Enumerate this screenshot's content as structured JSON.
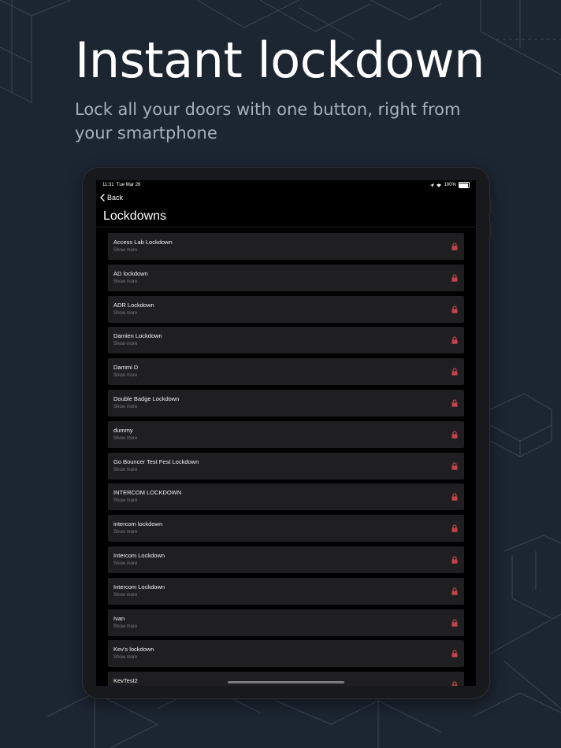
{
  "promo": {
    "headline": "Instant lockdown",
    "subtitle": "Lock all your doors with one button, right from your smartphone"
  },
  "status_bar": {
    "time": "11:31",
    "date": "Tue Mar 26",
    "icons": [
      "location-icon",
      "wifi-icon"
    ],
    "battery": "100%"
  },
  "nav": {
    "back_label": "Back",
    "title": "Lockdowns"
  },
  "lockdowns": [
    {
      "name": "Access Lab Lockdown",
      "sub": "Show more"
    },
    {
      "name": "AD lockdown",
      "sub": "Show more"
    },
    {
      "name": "ADR Lockdown",
      "sub": "Show more"
    },
    {
      "name": "Damien Lockdown",
      "sub": "Show more"
    },
    {
      "name": "Dammi D",
      "sub": "Show more"
    },
    {
      "name": "Double Badge Lockdown",
      "sub": "Show more"
    },
    {
      "name": "dummy",
      "sub": "Show more"
    },
    {
      "name": "Go Bouncer Test Fest Lockdown",
      "sub": "Show more"
    },
    {
      "name": "INTERCOM LOCKDOWN",
      "sub": "Show more"
    },
    {
      "name": "intercom lockdown",
      "sub": "Show more"
    },
    {
      "name": "Intercom Lockdown",
      "sub": "Show more"
    },
    {
      "name": "Intercom Lockdown",
      "sub": "Show more"
    },
    {
      "name": "Ivan",
      "sub": "Show more"
    },
    {
      "name": "Kev's lockdown",
      "sub": "Show more"
    },
    {
      "name": "KevTest2",
      "sub": ""
    }
  ],
  "colors": {
    "background": "#1c2631",
    "lock_icon": "#c1444b",
    "row_background": "#1f1f21"
  }
}
